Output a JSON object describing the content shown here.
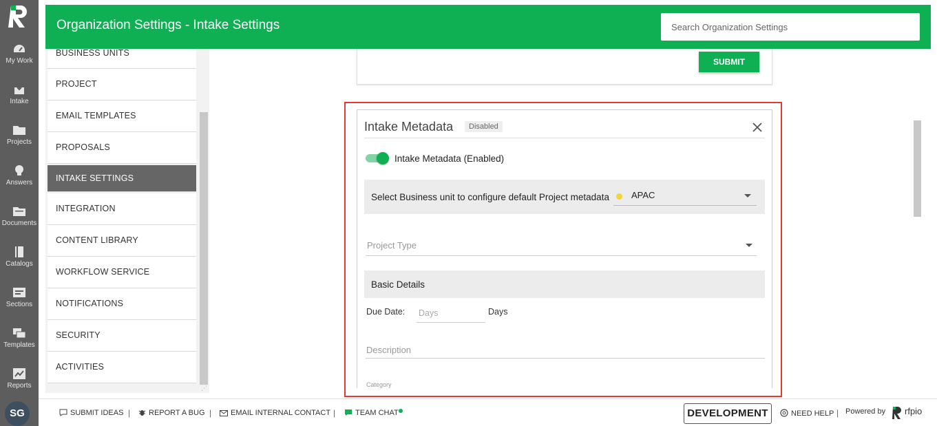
{
  "rail": {
    "items": [
      {
        "icon": "dashboard-icon",
        "label": "My Work"
      },
      {
        "icon": "intake-icon",
        "label": "Intake"
      },
      {
        "icon": "folder-icon",
        "label": "Projects"
      },
      {
        "icon": "lightbulb-icon",
        "label": "Answers"
      },
      {
        "icon": "documents-icon",
        "label": "Documents"
      },
      {
        "icon": "catalog-icon",
        "label": "Catalogs"
      },
      {
        "icon": "sections-icon",
        "label": "Sections"
      },
      {
        "icon": "templates-icon",
        "label": "Templates"
      },
      {
        "icon": "reports-icon",
        "label": "Reports"
      }
    ],
    "avatar_initials": "SG"
  },
  "header": {
    "title": "Organization Settings - Intake Settings",
    "search_placeholder": "Search Organization Settings",
    "color": "#0fb054"
  },
  "nav": {
    "items": [
      "BUSINESS UNITS",
      "PROJECT",
      "EMAIL TEMPLATES",
      "PROPOSALS",
      "INTAKE SETTINGS",
      "INTEGRATION",
      "CONTENT LIBRARY",
      "WORKFLOW SERVICE",
      "NOTIFICATIONS",
      "SECURITY",
      "ACTIVITIES"
    ],
    "active": "INTAKE SETTINGS"
  },
  "top_card": {
    "submit_label": "SUBMIT"
  },
  "metadata": {
    "title": "Intake Metadata",
    "badge": "Disabled",
    "toggle_label": "Intake Metadata (Enabled)",
    "toggle_on": true,
    "bu_label": "Select Business unit to configure default Project metadata",
    "bu_value": "APAC",
    "bu_dot_color": "#f5d33b",
    "project_type_placeholder": "Project Type",
    "basic_details": "Basic Details",
    "due_date_label": "Due Date:",
    "due_date_placeholder": "Days",
    "due_date_unit": "Days",
    "description_placeholder": "Description",
    "category_label": "Category"
  },
  "footer": {
    "submit_ideas": "SUBMIT IDEAS",
    "report_bug": "REPORT A BUG",
    "email_contact": "EMAIL INTERNAL CONTACT",
    "team_chat": "TEAM CHAT",
    "environment": "DEVELOPMENT",
    "need_help": "NEED HELP",
    "powered_by": "Powered by",
    "brand": "rfpio"
  }
}
